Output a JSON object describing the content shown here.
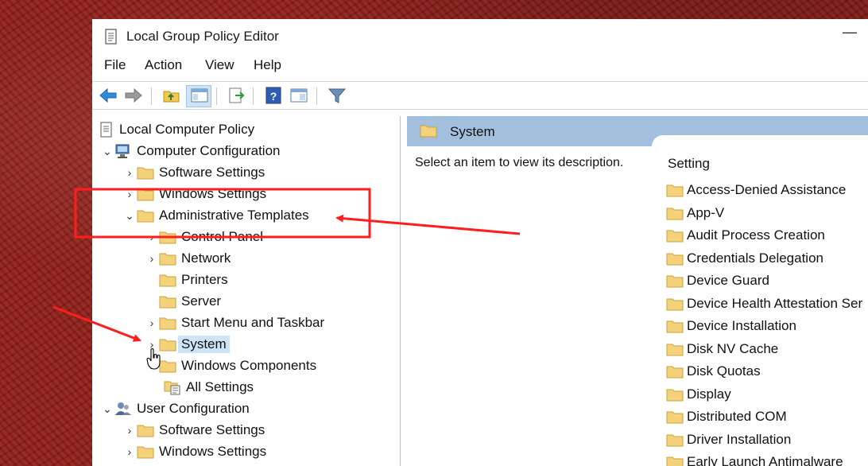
{
  "window": {
    "title": "Local Group Policy Editor",
    "minimize_glyph": "—"
  },
  "menu": {
    "items": [
      "File",
      "Action",
      "View",
      "Help"
    ]
  },
  "toolbar": {
    "icons": [
      "back-arrow-icon",
      "forward-arrow-icon",
      "up-folder-icon",
      "show-hide-tree-icon",
      "export-list-icon",
      "help-icon",
      "properties-view-icon",
      "filter-icon"
    ]
  },
  "tree": {
    "root": "Local Computer Policy",
    "computer_config": "Computer Configuration",
    "software_settings": "Software Settings",
    "windows_settings": "Windows Settings",
    "admin_templates": "Administrative Templates",
    "control_panel": "Control Panel",
    "network": "Network",
    "printers": "Printers",
    "server": "Server",
    "start_menu": "Start Menu and Taskbar",
    "system": "System",
    "windows_components": "Windows Components",
    "all_settings": "All Settings",
    "user_config": "User Configuration",
    "user_software_settings": "Software Settings",
    "user_windows_settings": "Windows Settings"
  },
  "right": {
    "header": "System",
    "description": "Select an item to view its description.",
    "column_setting": "Setting",
    "items": [
      "Access-Denied Assistance",
      "App-V",
      "Audit Process Creation",
      "Credentials Delegation",
      "Device Guard",
      "Device Health Attestation Ser",
      "Device Installation",
      "Disk NV Cache",
      "Disk Quotas",
      "Display",
      "Distributed COM",
      "Driver Installation",
      "Early Launch Antimalware"
    ]
  },
  "colors": {
    "annotation": "#ff1e1e",
    "folder": "#f4d27a",
    "header": "#a3bfde",
    "selection": "#cce4f7"
  }
}
